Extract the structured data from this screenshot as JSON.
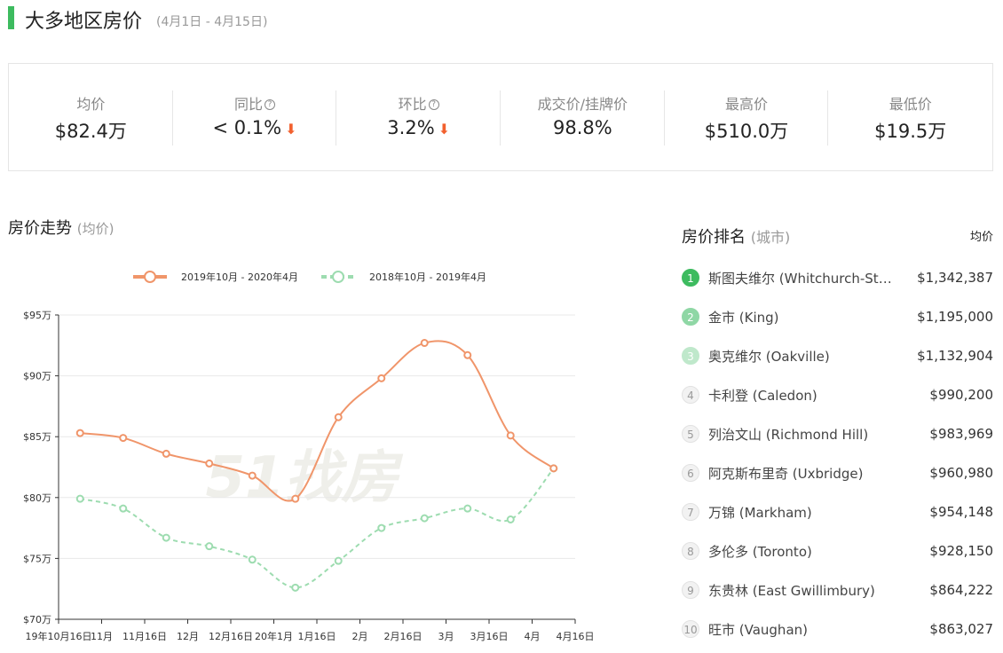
{
  "header": {
    "title": "大多地区房价",
    "range": "(4月1日 - 4月15日)",
    "accent": "#3dbb5f"
  },
  "stats": [
    {
      "label": "均价",
      "value": "$82.4万",
      "help": false,
      "trend": ""
    },
    {
      "label": "同比",
      "value": "< 0.1%",
      "help": true,
      "trend": "down"
    },
    {
      "label": "环比",
      "value": "3.2%",
      "help": true,
      "trend": "down"
    },
    {
      "label": "成交价/挂牌价",
      "value": "98.8%",
      "help": false,
      "trend": ""
    },
    {
      "label": "最高价",
      "value": "$510.0万",
      "help": false,
      "trend": ""
    },
    {
      "label": "最低价",
      "value": "$19.5万",
      "help": false,
      "trend": ""
    }
  ],
  "chart_section": {
    "title": "房价走势",
    "subtitle": "(均价)"
  },
  "chart_data": {
    "type": "line",
    "categories": [
      "19年10月16日",
      "11月",
      "11月16日",
      "12月",
      "12月16日",
      "20年1月",
      "1月16日",
      "2月",
      "2月16日",
      "3月",
      "3月16日",
      "4月",
      "4月16日"
    ],
    "y_ticks": [
      "$70万",
      "$75万",
      "$80万",
      "$85万",
      "$90万",
      "$95万"
    ],
    "ylim": [
      70,
      95
    ],
    "watermark": "51找房",
    "series": [
      {
        "name": "2019年10月 - 2020年4月",
        "color": "#f0956a",
        "dashed": false,
        "values": [
          85.3,
          84.9,
          83.6,
          82.8,
          81.8,
          79.9,
          86.6,
          89.8,
          92.7,
          91.7,
          85.1,
          82.4
        ]
      },
      {
        "name": "2018年10月 - 2019年4月",
        "color": "#9ddcb0",
        "dashed": true,
        "values": [
          79.9,
          79.1,
          76.7,
          76.0,
          74.9,
          72.6,
          74.8,
          77.5,
          78.3,
          79.1,
          78.2,
          82.4
        ]
      }
    ]
  },
  "ranking": {
    "title": "房价排名",
    "subtitle": "(城市)",
    "column_header": "均价",
    "items": [
      {
        "rank": "1",
        "name": "斯图夫维尔 (Whitchurch-Sto...",
        "price": "$1,342,387"
      },
      {
        "rank": "2",
        "name": "金市 (King)",
        "price": "$1,195,000"
      },
      {
        "rank": "3",
        "name": "奥克维尔 (Oakville)",
        "price": "$1,132,904"
      },
      {
        "rank": "4",
        "name": "卡利登 (Caledon)",
        "price": "$990,200"
      },
      {
        "rank": "5",
        "name": "列治文山 (Richmond Hill)",
        "price": "$983,969"
      },
      {
        "rank": "6",
        "name": "阿克斯布里奇 (Uxbridge)",
        "price": "$960,980"
      },
      {
        "rank": "7",
        "name": "万锦 (Markham)",
        "price": "$954,148"
      },
      {
        "rank": "8",
        "name": "多伦多 (Toronto)",
        "price": "$928,150"
      },
      {
        "rank": "9",
        "name": "东贵林 (East Gwillimbury)",
        "price": "$864,222"
      },
      {
        "rank": "10",
        "name": "旺市 (Vaughan)",
        "price": "$863,027"
      }
    ]
  }
}
